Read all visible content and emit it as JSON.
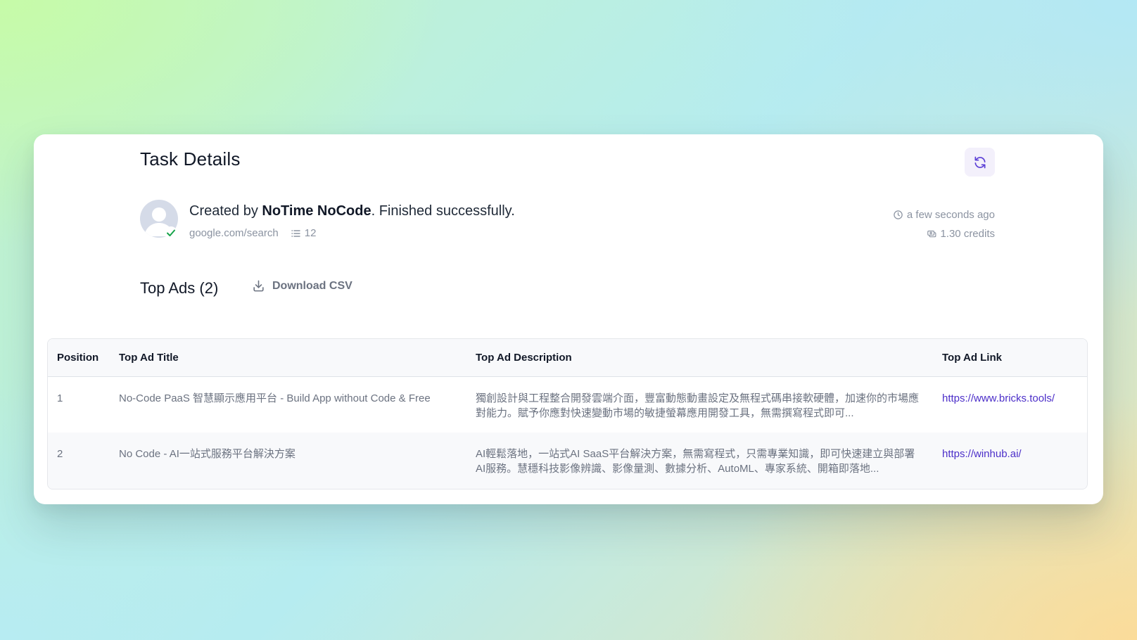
{
  "header": {
    "title": "Task Details"
  },
  "task": {
    "created_prefix": "Created by ",
    "creator": "NoTime NoCode",
    "status_text": ". Finished successfully.",
    "source_url": "google.com/search",
    "result_count": "12",
    "time_ago": "a few seconds ago",
    "credits": "1.30 credits"
  },
  "section": {
    "title": "Top Ads (2)",
    "download_label": "Download CSV"
  },
  "table": {
    "columns": [
      "Position",
      "Top Ad Title",
      "Top Ad Description",
      "Top Ad Link"
    ],
    "rows": [
      {
        "position": "1",
        "title": "No-Code PaaS 智慧顯示應用平台 - Build App without Code & Free",
        "description": "獨創設計與工程整合開發雲端介面，豐富動態動畫設定及無程式碼串接軟硬體，加速你的市場應對能力。賦予你應對快速變動市場的敏捷螢幕應用開發工具，無需撰寫程式即可...",
        "link": "https://www.bricks.tools/"
      },
      {
        "position": "2",
        "title": "No Code - AI一站式服務平台解決方案",
        "description": "AI輕鬆落地，一站式AI SaaS平台解決方案，無需寫程式，只需專業知識，即可快速建立與部署AI服務。慧穩科技影像辨識、影像量測、數據分析、AutoML、專家系統、開箱即落地...",
        "link": "https://winhub.ai/"
      }
    ]
  },
  "colors": {
    "accent": "#4c2fc9",
    "success": "#16a34a"
  },
  "icons": {
    "refresh": "refresh-icon",
    "avatar": "user-avatar-icon",
    "check": "check-icon",
    "list": "list-icon",
    "clock": "clock-icon",
    "credits": "coins-icon",
    "download": "download-icon"
  }
}
